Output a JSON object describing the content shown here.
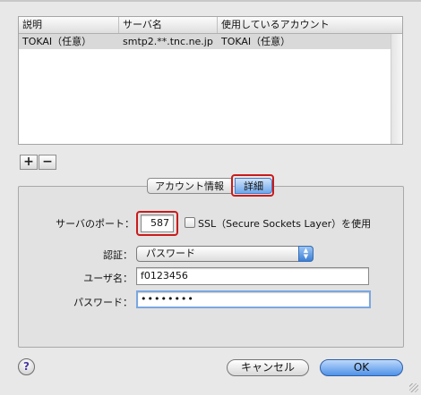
{
  "server_table": {
    "columns": [
      "説明",
      "サーバ名",
      "使用しているアカウント"
    ],
    "rows": [
      {
        "description": "TOKAI（任意）",
        "server": "smtp2.**.tnc.ne.jp",
        "account": "TOKAI（任意）"
      }
    ]
  },
  "list_buttons": {
    "add": "+",
    "remove": "−"
  },
  "tabs": {
    "account_info": "アカウント情報",
    "advanced": "詳細"
  },
  "form": {
    "port_label": "サーバのポート：",
    "port_value": "587",
    "ssl_label": "SSL（Secure Sockets Layer）を使用",
    "auth_label": "認証：",
    "auth_value": "パスワード",
    "username_label": "ユーザ名：",
    "username_value": "f0123456",
    "password_label": "パスワード：",
    "password_value": "••••••••"
  },
  "buttons": {
    "help": "?",
    "cancel": "キャンセル",
    "ok": "OK"
  },
  "icons": {
    "help": "help-icon",
    "popup": "up-down-arrows-icon",
    "add": "plus-icon",
    "remove": "minus-icon"
  },
  "colors": {
    "highlight_ring": "#c81c1c",
    "accent": "#4f92e8"
  }
}
